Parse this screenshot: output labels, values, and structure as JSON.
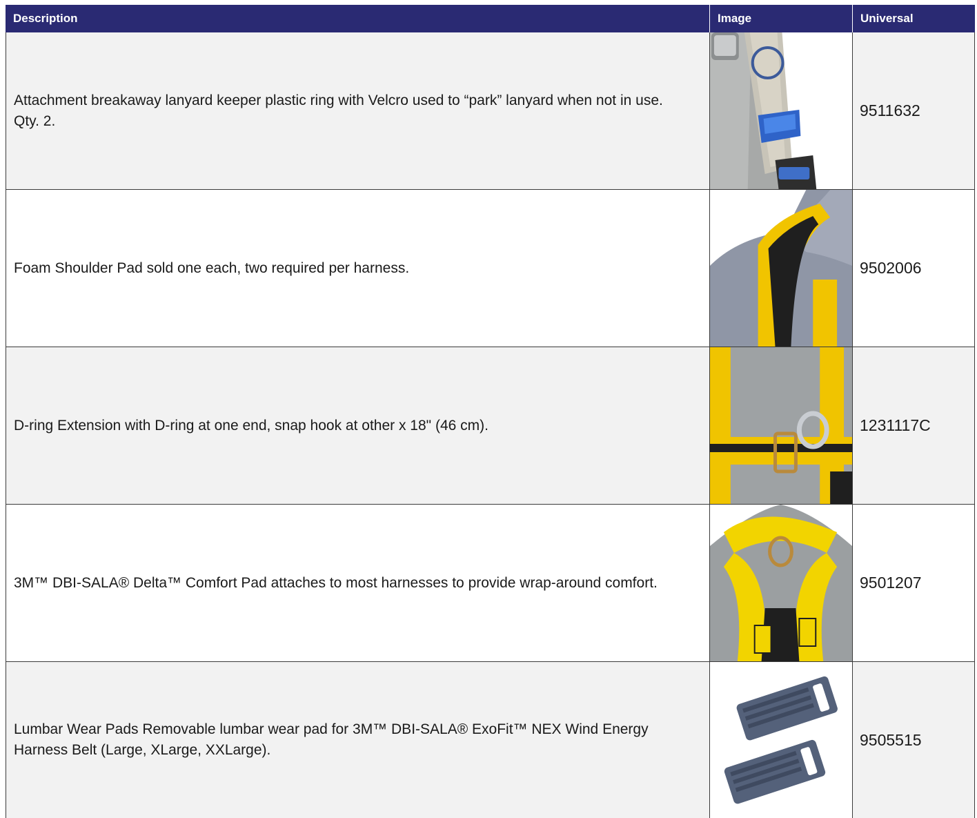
{
  "table": {
    "headers": {
      "description": "Description",
      "image": "Image",
      "universal": "Universal"
    },
    "header_color": "#2a2a73",
    "rows": [
      {
        "description": "Attachment breakaway lanyard keeper plastic ring with Velcro used to “park” lanyard when not in use. Qty. 2.",
        "image": "lanyard-keeper-photo",
        "universal": "9511632"
      },
      {
        "description": "Foam Shoulder Pad sold one each, two required per harness.",
        "image": "shoulder-pad-photo",
        "universal": "9502006"
      },
      {
        "description": "D-ring Extension with D-ring at one end, snap hook at other x 18\" (46 cm).",
        "image": "d-ring-extension-photo",
        "universal": "1231117C"
      },
      {
        "description": "3M™ DBI-SALA® Delta™ Comfort Pad attaches to most harnesses to provide wrap-around comfort.",
        "image": "comfort-pad-photo",
        "universal": "9501207"
      },
      {
        "description": "Lumbar Wear Pads Removable lumbar wear pad for 3M™ DBI-SALA® ExoFit™ NEX Wind Energy Harness Belt (Large, XLarge, XXLarge).",
        "image": "lumbar-wear-pads-photo",
        "universal": "9505515"
      }
    ]
  }
}
